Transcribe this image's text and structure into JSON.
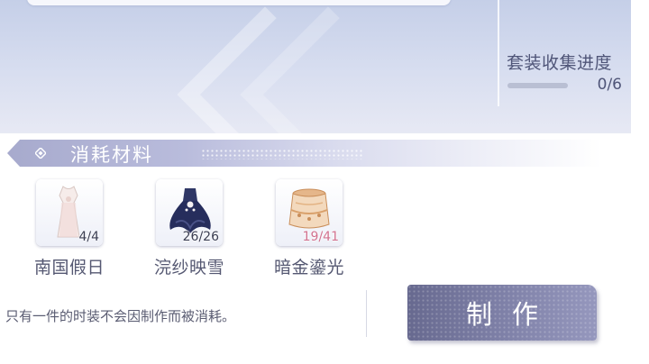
{
  "collection": {
    "label": "套装收集进度",
    "count": "0/6",
    "progress": 0
  },
  "materials_section": {
    "title": "消耗材料"
  },
  "materials": [
    {
      "name": "南国假日",
      "count": "4/4",
      "icon": "white-dress-icon",
      "sufficient": true
    },
    {
      "name": "浣纱映雪",
      "count": "26/26",
      "icon": "navy-tutu-dress-icon",
      "sufficient": true
    },
    {
      "name": "暗金鎏光",
      "count": "19/41",
      "icon": "gold-skirt-icon",
      "sufficient": false
    }
  ],
  "note": "只有一件的时装不会因制作而被消耗。",
  "craft_button": {
    "label": "制作"
  },
  "colors": {
    "accent": "#7e80a7",
    "insufficient": "#d2728f"
  }
}
